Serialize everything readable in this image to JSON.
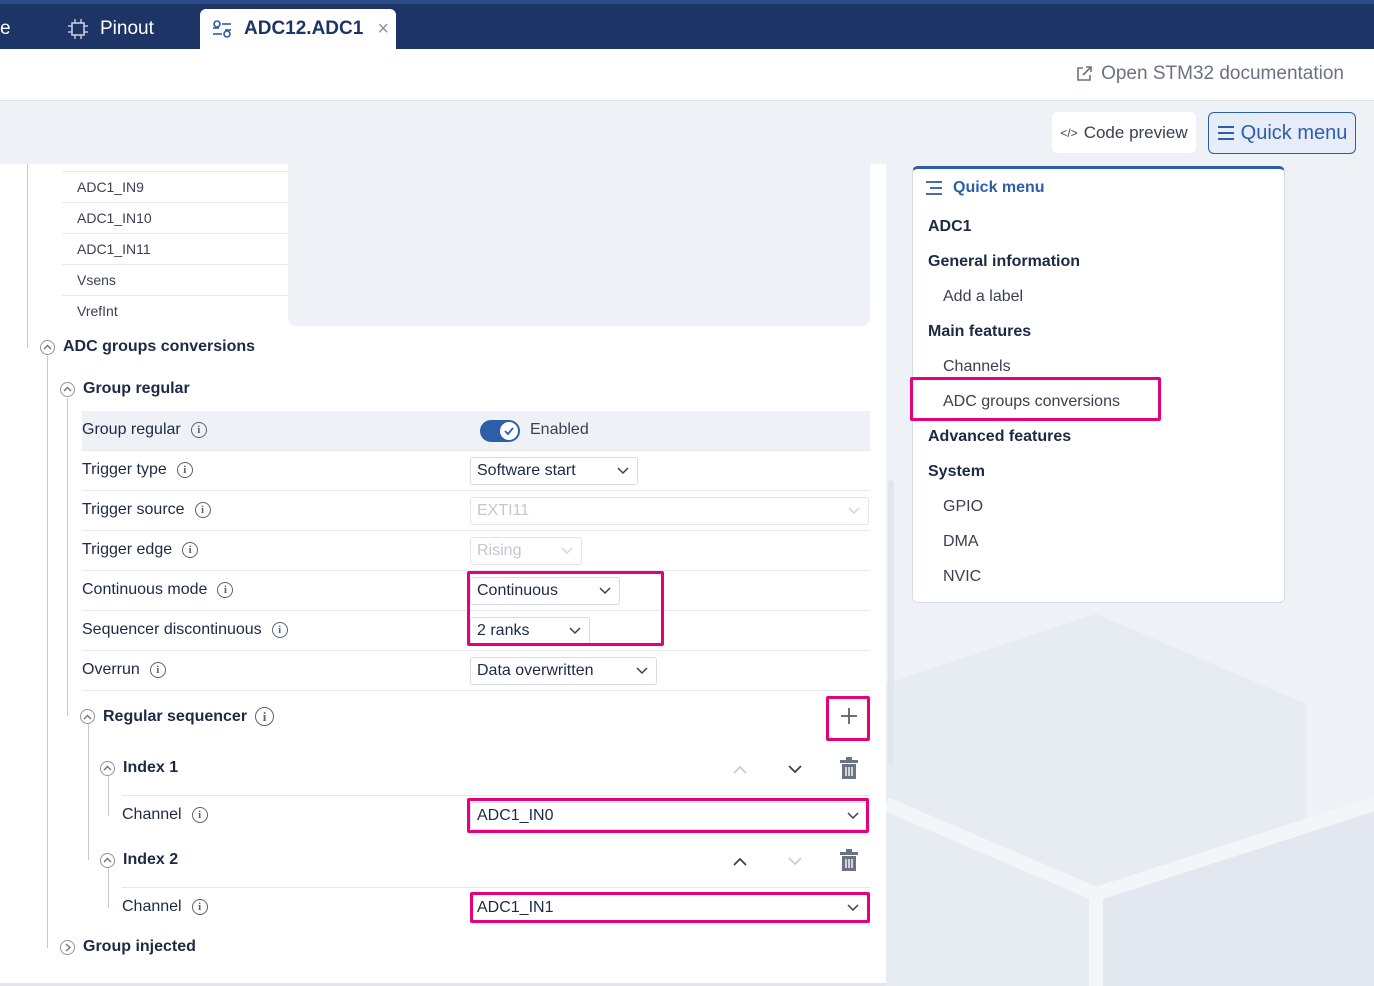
{
  "tabs": [
    {
      "label": "e"
    },
    {
      "label": "Pinout"
    },
    {
      "label": "ADC12.ADC1",
      "close": "×"
    }
  ],
  "doc_link": "Open STM32 documentation",
  "toolbar": {
    "code_preview": "Code preview",
    "quick_menu": "Quick menu"
  },
  "channel_list": [
    "ADC1_IN9",
    "ADC1_IN10",
    "ADC1_IN11",
    "Vsens",
    "VrefInt"
  ],
  "sections": {
    "adc_groups": "ADC groups conversions",
    "group_regular": "Group regular",
    "regular_sequencer": "Regular sequencer",
    "index1": "Index 1",
    "index2": "Index 2",
    "group_injected": "Group injected"
  },
  "params": {
    "group_regular": {
      "label": "Group regular",
      "value": "Enabled"
    },
    "trigger_type": {
      "label": "Trigger type",
      "value": "Software start"
    },
    "trigger_source": {
      "label": "Trigger source",
      "value": "EXTI11"
    },
    "trigger_edge": {
      "label": "Trigger edge",
      "value": "Rising"
    },
    "continuous_mode": {
      "label": "Continuous mode",
      "value": "Continuous"
    },
    "seq_discontinuous": {
      "label": "Sequencer discontinuous",
      "value": "2 ranks"
    },
    "overrun": {
      "label": "Overrun",
      "value": "Data overwritten"
    },
    "index1_channel": {
      "label": "Channel",
      "value": "ADC1_IN0"
    },
    "index2_channel": {
      "label": "Channel",
      "value": "ADC1_IN1"
    }
  },
  "quick_menu": {
    "title": "Quick menu",
    "adc1": "ADC1",
    "general_information": "General information",
    "add_label": "Add a label",
    "main_features": "Main features",
    "channels": "Channels",
    "adc_groups": "ADC groups conversions",
    "advanced_features": "Advanced features",
    "system": "System",
    "gpio": "GPIO",
    "dma": "DMA",
    "nvic": "NVIC"
  },
  "colors": {
    "accent": "#2c5fa8",
    "highlight": "#e5007d",
    "tabbar": "#1d3566"
  }
}
